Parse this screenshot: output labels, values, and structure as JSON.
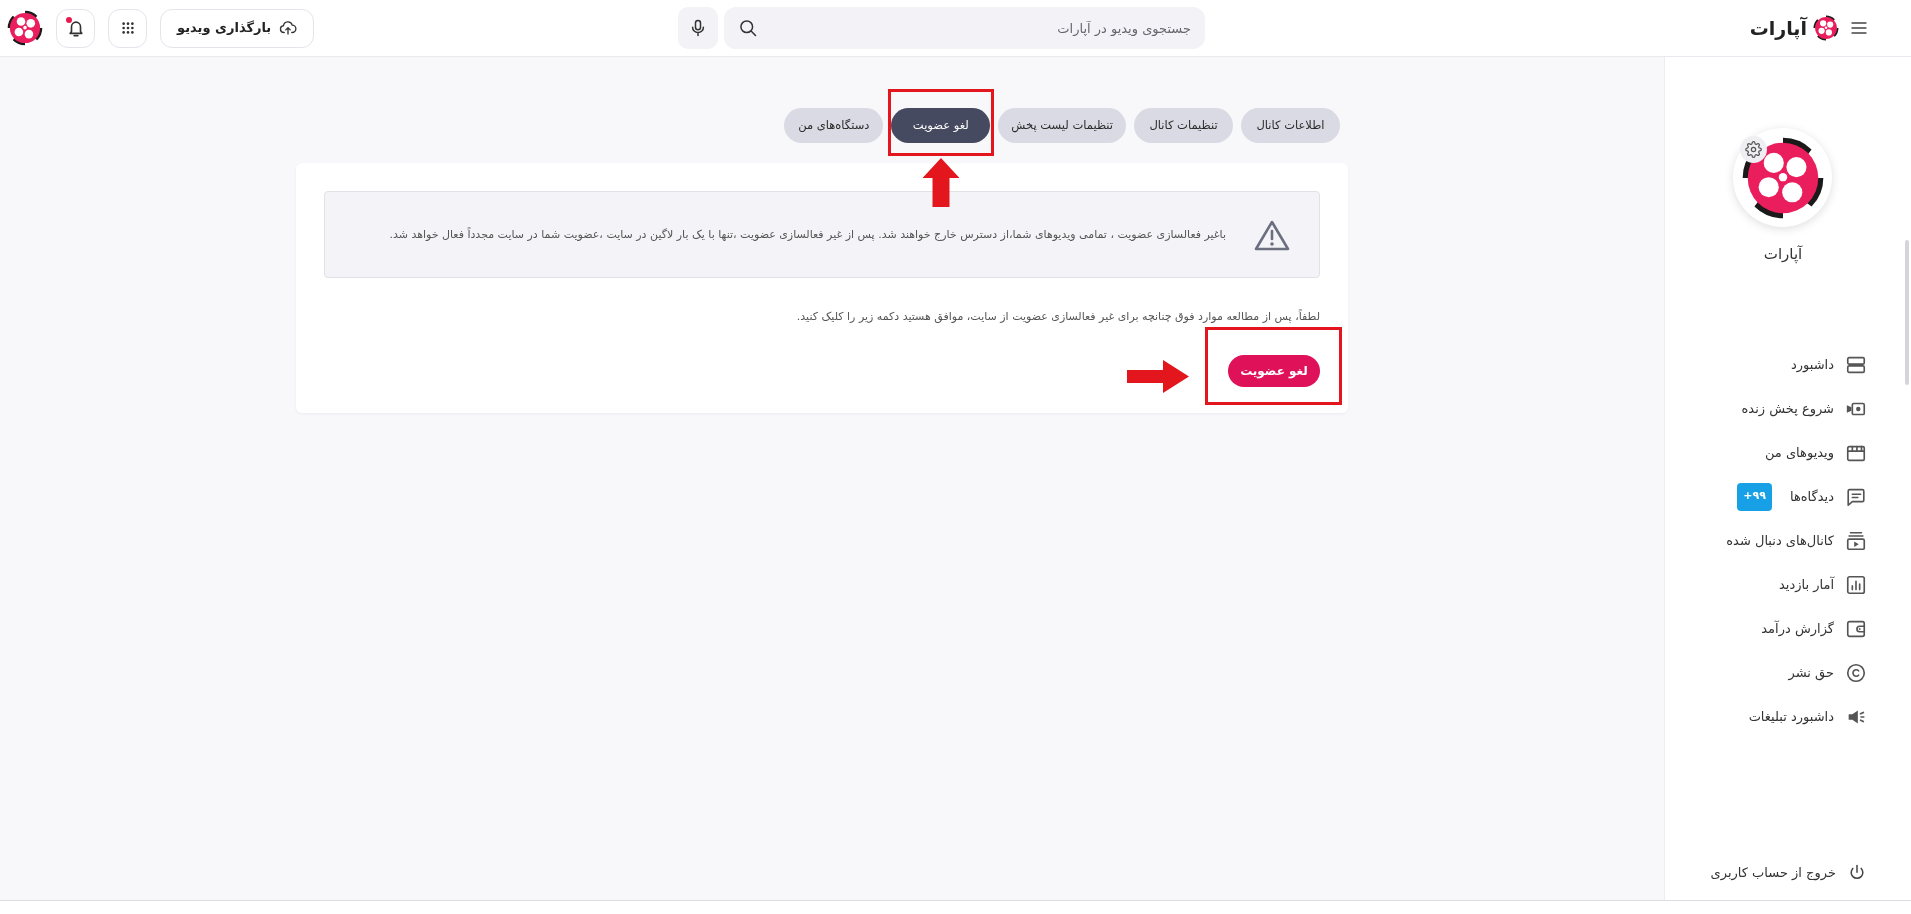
{
  "header": {
    "logo_text": "آپارات",
    "search": {
      "placeholder": "جستجوی ویدیو در آپارات"
    },
    "upload_button": "بارگذاری ویدیو",
    "notifications": {
      "unread": true
    }
  },
  "tabs": [
    {
      "label": "اطلاعات کانال",
      "selected": false
    },
    {
      "label": "تنظیمات کانال",
      "selected": false
    },
    {
      "label": "تنظیمات لیست پخش",
      "selected": false
    },
    {
      "label": "لغو عضویت",
      "selected": true
    },
    {
      "label": "دستگاه‌های من",
      "selected": false
    }
  ],
  "warning": {
    "text": "باغیر فعالسازی عضویت ، تمامی ویدیوهای شما،از دسترس خارج خواهند شد. پس از غیر فعالسازی عضویت ،تنها با یک بار لاگین در سایت ،عضویت شما در سایت مجدداً فعال خواهد شد."
  },
  "instruction": "لطفاً، پس از مطالعه موارد فوق چنانچه برای غیر فعالسازی عضویت از سایت، موافق هستید دکمه زیر را کلیک کنید.",
  "cancel_button": "لغو عضویت",
  "sidebar": {
    "channel_name": "آپارات",
    "menu": [
      {
        "label": "داشبورد"
      },
      {
        "label": "شروع پخش زنده"
      },
      {
        "label": "ویدیوهای من"
      },
      {
        "label": "دیدگاه‌ها",
        "badge": "۹۹+"
      },
      {
        "label": "کانال‌های دنبال شده"
      },
      {
        "label": "آمار بازدید"
      },
      {
        "label": "گزارش درآمد"
      },
      {
        "label": "حق نشر"
      },
      {
        "label": "داشبورد تبلیغات"
      }
    ],
    "logout": "خروج از حساب کاربری"
  }
}
